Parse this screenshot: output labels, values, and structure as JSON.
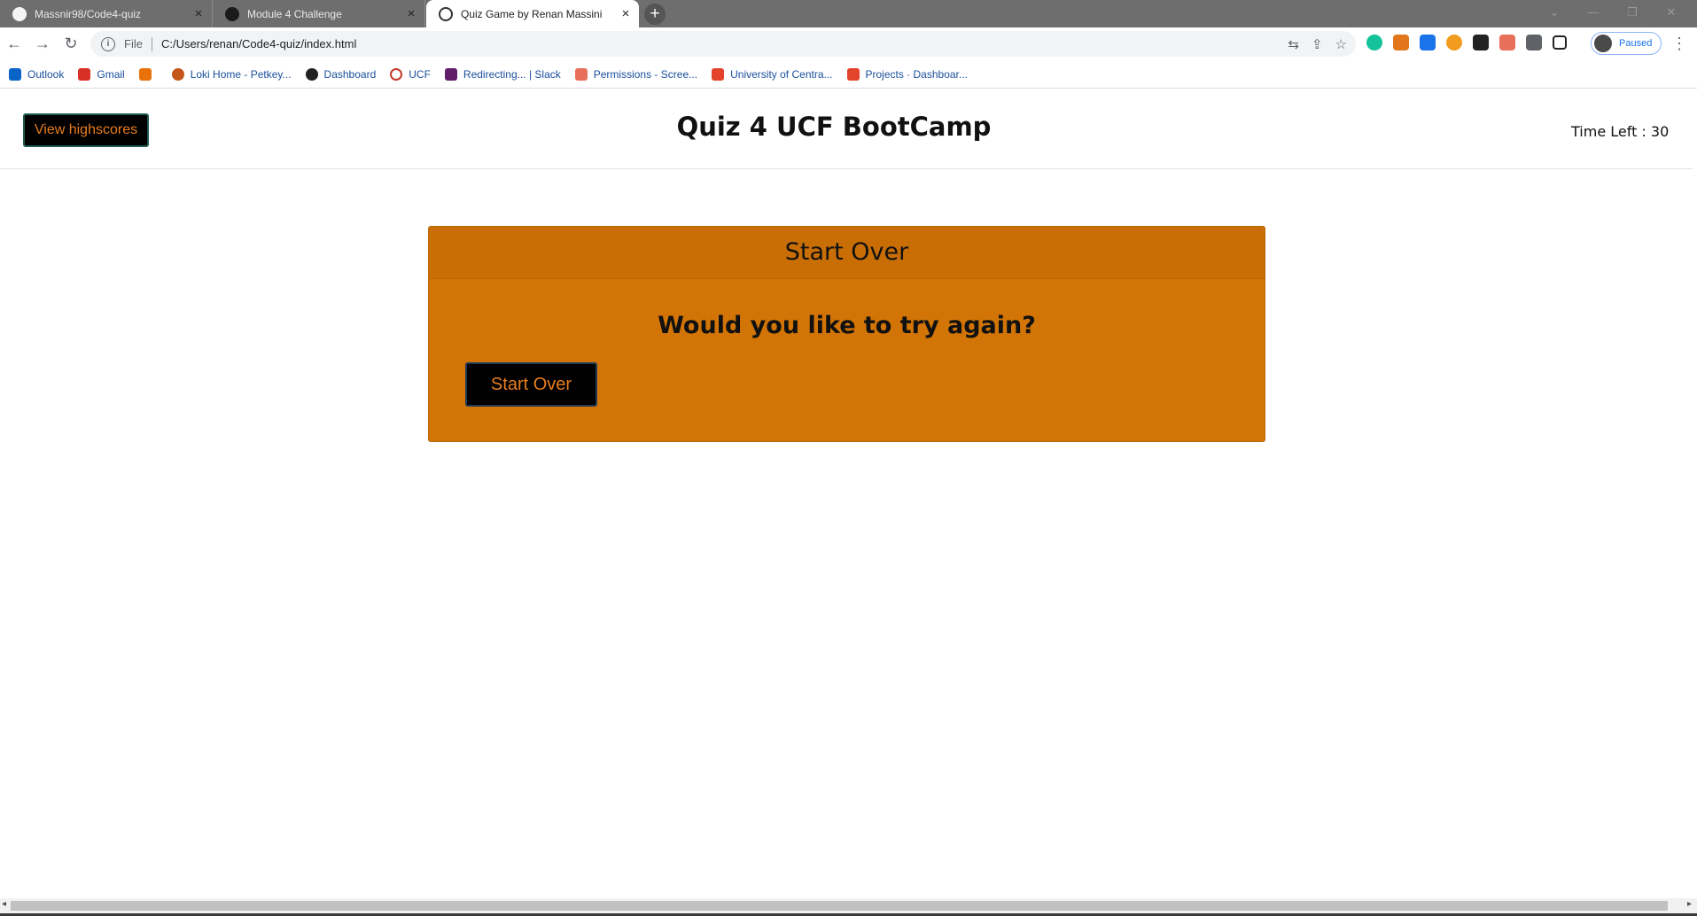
{
  "browser": {
    "tabs": [
      {
        "label": "Massnir98/Code4-quiz",
        "active": false
      },
      {
        "label": "Module 4 Challenge",
        "active": false
      },
      {
        "label": "Quiz Game by Renan Massini",
        "active": true
      }
    ],
    "new_tab": "+",
    "address": {
      "scheme": "File",
      "url": "C:/Users/renan/Code4-quiz/index.html"
    },
    "profile_status": "Paused",
    "bookmarks": [
      {
        "label": "Outlook",
        "color": "#0a64c8"
      },
      {
        "label": "Gmail",
        "color": "#d93025"
      },
      {
        "label": "",
        "color": "#e8710a"
      },
      {
        "label": "Loki Home - Petkey...",
        "color": "#c4561a"
      },
      {
        "label": "Dashboard",
        "color": "#222222"
      },
      {
        "label": "UCF",
        "color": "#c43a2a"
      },
      {
        "label": "Redirecting... | Slack",
        "color": "#611f69"
      },
      {
        "label": "Permissions - Scree...",
        "color": "#e86f5a"
      },
      {
        "label": "University of Centra...",
        "color": "#e2432a"
      },
      {
        "label": "Projects · Dashboar...",
        "color": "#e2432a"
      }
    ]
  },
  "header": {
    "highscores_label": "View highscores",
    "title": "Quiz 4 UCF BootCamp",
    "timer_text": "Time Left : 30"
  },
  "card": {
    "header": "Start Over",
    "question": "Would you like to try again?",
    "button_label": "Start Over"
  },
  "colors": {
    "accent_orange": "#d27506",
    "button_text": "#e87c1e"
  }
}
